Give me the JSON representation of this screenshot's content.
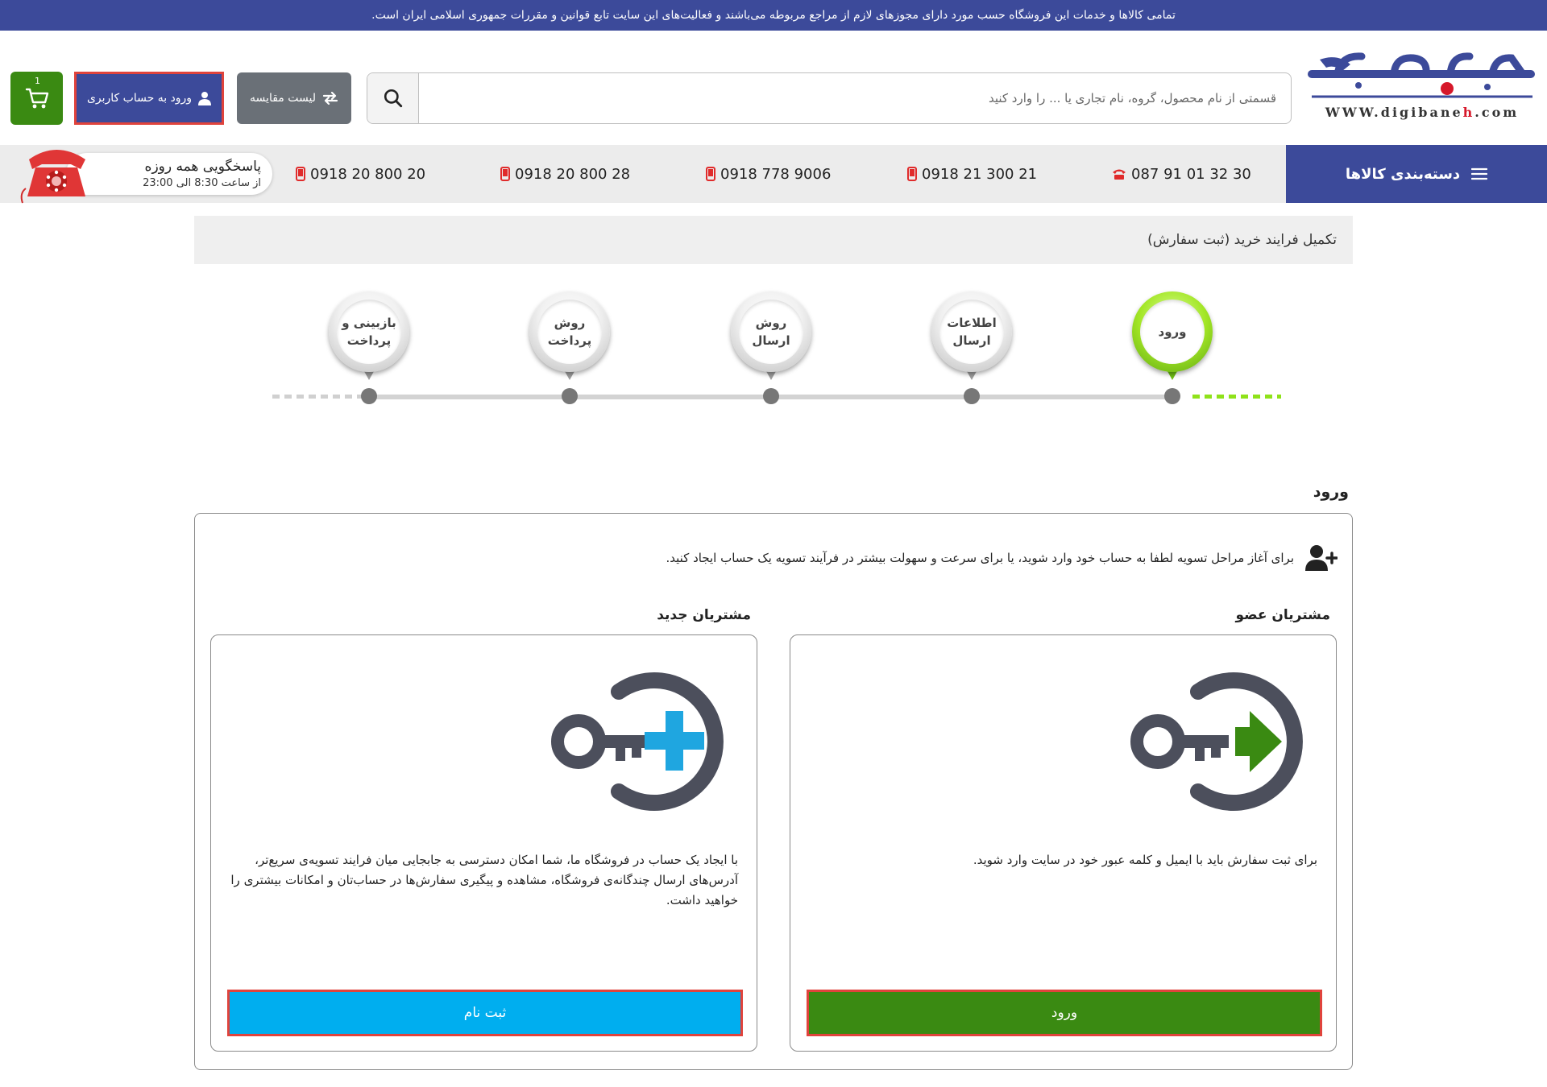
{
  "notice": "تمامی کالاها و خدمات این فروشگاه حسب مورد دارای مجوزهای لازم از مراجع مربوطه می‌باشند و فعالیت‌های این سایت تابع قوانین و مقررات جمهوری اسلامی ایران است.",
  "header": {
    "logo_url_text": {
      "prefix": "WWW.digibane",
      "accent": "h",
      "suffix": ".com"
    },
    "search_placeholder": "قسمتی از نام محصول، گروه، نام تجاری یا ... را وارد کنید",
    "compare_label": "لیست مقایسه",
    "login_label": "ورود به حساب کاربری",
    "cart_count": "1"
  },
  "phone_strip": {
    "category_label": "دسته‌بندی کالاها",
    "phones": [
      {
        "number": "087 91 01 32 30",
        "kind": "landline"
      },
      {
        "number": "0918 21 300 21",
        "kind": "mobile"
      },
      {
        "number": "0918 778 9006",
        "kind": "mobile"
      },
      {
        "number": "0918 20 800 28",
        "kind": "mobile"
      },
      {
        "number": "0918 20 800 20",
        "kind": "mobile"
      }
    ],
    "support_title": "پاسخگویی همه روزه",
    "support_hours": "از ساعت 8:30 الی 23:00"
  },
  "page_title": "تکمیل فرایند خرید (ثبت سفارش)",
  "steps": [
    {
      "label": "ورود",
      "state": "active"
    },
    {
      "label": "اطلاعات ارسال",
      "state": "pending"
    },
    {
      "label": "روش ارسال",
      "state": "pending"
    },
    {
      "label": "روش پرداخت",
      "state": "pending"
    },
    {
      "label": "بازبینی و پرداخت",
      "state": "pending"
    }
  ],
  "login_section": {
    "heading": "ورود",
    "intro": "برای آغاز مراحل تسویه لطفا به حساب خود وارد شوید، یا برای سرعت و سهولت بیشتر در فرآیند تسویه یک حساب ایجاد کنید.",
    "members": {
      "heading": "مشتریان عضو",
      "text": "برای ثبت سفارش باید با ایمیل و کلمه عبور خود در سایت وارد شوید.",
      "button": "ورود",
      "button_color": "#3a8a12"
    },
    "new_customers": {
      "heading": "مشتریان جدید",
      "text": "با ایجاد یک حساب در فروشگاه ما، شما امکان دسترسی به جابجایی میان فرایند تسویه‌ی سریع‌تر، آدرس‌های ارسال چندگانه‌ی فروشگاه، مشاهده و پیگیری سفارش‌ها در حساب‌تان و امکانات بیشتری را خواهید داشت.",
      "button": "ثبت نام",
      "button_color": "#00aeef"
    }
  },
  "colors": {
    "brand_blue": "#3c4a9a",
    "compare_gray": "#6a7077",
    "cart_green": "#3a8a12",
    "active_step": "#8fe21a",
    "highlight_border": "#e0433c"
  }
}
